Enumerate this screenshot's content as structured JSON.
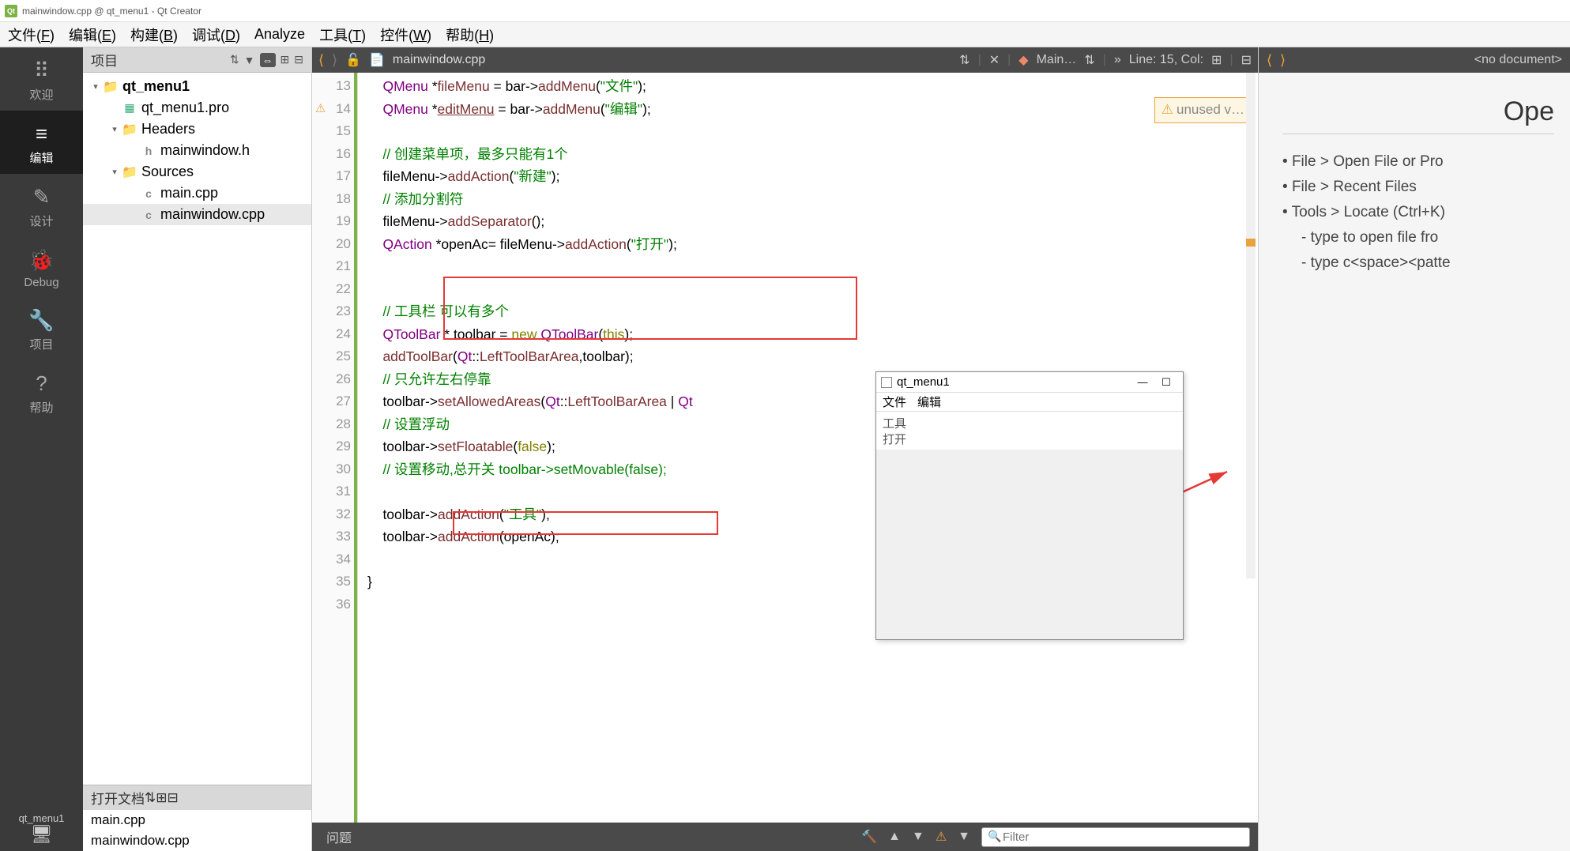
{
  "title": "mainwindow.cpp @ qt_menu1 - Qt Creator",
  "menubar": [
    "文件(F)",
    "编辑(E)",
    "构建(B)",
    "调试(D)",
    "Analyze",
    "工具(T)",
    "控件(W)",
    "帮助(H)"
  ],
  "leftbar": {
    "modes": [
      {
        "icon": "⠿",
        "label": "欢迎"
      },
      {
        "icon": "≡",
        "label": "编辑",
        "active": true
      },
      {
        "icon": "✎",
        "label": "设计"
      },
      {
        "icon": "🐞",
        "label": "Debug"
      },
      {
        "icon": "🔧",
        "label": "项目"
      },
      {
        "icon": "?",
        "label": "帮助"
      }
    ],
    "bottom": {
      "icon": "🖥",
      "label": "qt_menu1"
    }
  },
  "project_pane": {
    "title": "项目",
    "tree": [
      {
        "lvl": 0,
        "tw": "▾",
        "ico": "folder",
        "txt": "qt_menu1",
        "bold": true
      },
      {
        "lvl": 1,
        "tw": "",
        "ico": "pro",
        "txt": "qt_menu1.pro"
      },
      {
        "lvl": 1,
        "tw": "▾",
        "ico": "folder",
        "txt": "Headers"
      },
      {
        "lvl": 2,
        "tw": "",
        "ico": "h",
        "txt": "mainwindow.h"
      },
      {
        "lvl": 1,
        "tw": "▾",
        "ico": "folder",
        "txt": "Sources"
      },
      {
        "lvl": 2,
        "tw": "",
        "ico": "cpp",
        "txt": "main.cpp"
      },
      {
        "lvl": 2,
        "tw": "",
        "ico": "cpp",
        "txt": "mainwindow.cpp",
        "sel": true
      }
    ],
    "open_docs_title": "打开文档",
    "open_docs": [
      "main.cpp",
      "mainwindow.cpp"
    ]
  },
  "editor": {
    "file": "mainwindow.cpp",
    "target": "Main…",
    "cursor": "Line: 15, Col:",
    "warn_label": "unused v…",
    "lines": [
      {
        "n": 13,
        "html": "    <span class='cls'>QMenu</span> *<span class='id'>fileMenu</span> = bar-&gt;<span class='fn'>addMenu</span>(<span class='str'>\"文件\"</span>);"
      },
      {
        "n": 14,
        "warn": true,
        "html": "    <span class='cls'>QMenu</span> *<span class='id'><u>editMenu</u></span> = bar-&gt;<span class='fn'>addMenu</span>(<span class='str'>\"编辑\"</span>);"
      },
      {
        "n": 15,
        "html": ""
      },
      {
        "n": 16,
        "html": "    <span class='cmt'>// 创建菜单项，最多只能有1个</span>"
      },
      {
        "n": 17,
        "html": "    fileMenu-&gt;<span class='fn'>addAction</span>(<span class='str'>\"新建\"</span>);"
      },
      {
        "n": 18,
        "html": "    <span class='cmt'>// 添加分割符</span>"
      },
      {
        "n": 19,
        "html": "    fileMenu-&gt;<span class='fn'>addSeparator</span>();"
      },
      {
        "n": 20,
        "html": "    <span class='cls'>QAction</span> *openAc= fileMenu-&gt;<span class='fn'>addAction</span>(<span class='str'>\"打开\"</span>);"
      },
      {
        "n": 21,
        "html": ""
      },
      {
        "n": 22,
        "html": ""
      },
      {
        "n": 23,
        "html": "    <span class='cmt'>// 工具栏 可以有多个</span>"
      },
      {
        "n": 24,
        "html": "    <span class='cls'>QToolBar</span> * toolbar = <span class='kw'>new</span> <span class='cls'>QToolBar</span>(<span class='this'>this</span>);"
      },
      {
        "n": 25,
        "html": "    <span class='fn'>addToolBar</span>(<span class='ns'>Qt</span>::<span class='id'>LeftToolBarArea</span>,toolbar);"
      },
      {
        "n": 26,
        "html": "    <span class='cmt'>// 只允许左右停靠</span>"
      },
      {
        "n": 27,
        "html": "    toolbar-&gt;<span class='fn'>setAllowedAreas</span>(<span class='ns'>Qt</span>::<span class='id'>LeftToolBarArea</span> | <span class='ns'>Qt</span>"
      },
      {
        "n": 28,
        "html": "    <span class='cmt'>// 设置浮动</span>"
      },
      {
        "n": 29,
        "html": "    toolbar-&gt;<span class='fn'>setFloatable</span>(<span class='kw'>false</span>);"
      },
      {
        "n": 30,
        "html": "    <span class='cmt'>// 设置移动,总开关 toolbar-&gt;setMovable(false);</span>"
      },
      {
        "n": 31,
        "html": ""
      },
      {
        "n": 32,
        "html": "    toolbar-&gt;<span class='fn'>addAction</span>(<span class='str'>\"工具\"</span>);"
      },
      {
        "n": 33,
        "html": "    toolbar-&gt;<span class='fn'>addAction</span>(openAc);"
      },
      {
        "n": 34,
        "html": ""
      },
      {
        "n": 35,
        "html": "}"
      },
      {
        "n": 36,
        "html": ""
      }
    ],
    "bottom_tab": "问题",
    "filter_placeholder": "Filter"
  },
  "rightpane": {
    "nodoc": "<no document>",
    "heading": "Ope",
    "items": [
      "File > Open File or Pro",
      "File > Recent Files",
      "Tools > Locate (Ctrl+K)"
    ],
    "subs": [
      "type to open file fro",
      "type c<space><patte"
    ]
  },
  "popup": {
    "title": "qt_menu1",
    "menu": [
      "文件",
      "编辑"
    ],
    "tool": [
      "工具",
      "打开"
    ]
  }
}
